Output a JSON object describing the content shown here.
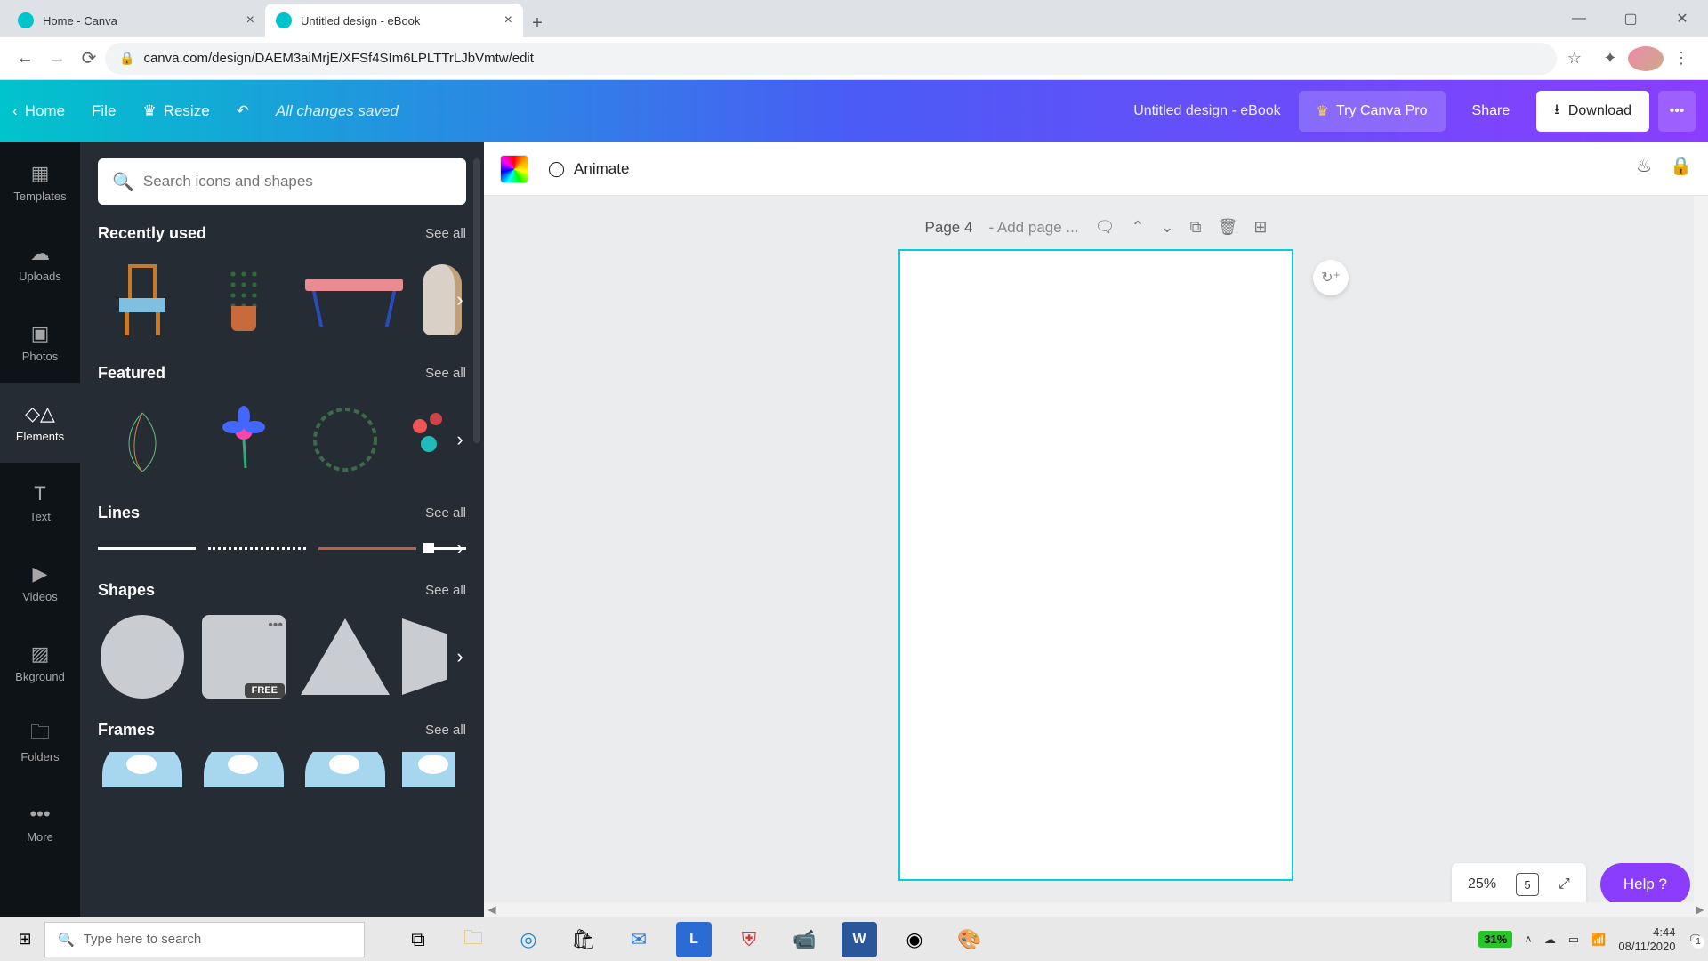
{
  "browser": {
    "tabs": [
      {
        "title": "Home - Canva",
        "active": false
      },
      {
        "title": "Untitled design - eBook",
        "active": true
      }
    ],
    "url": "canva.com/design/DAEM3aiMrjE/XFSf4SIm6LPLTTrLJbVmtw/edit"
  },
  "top": {
    "home": "Home",
    "file": "File",
    "resize": "Resize",
    "saved": "All changes saved",
    "title": "Untitled design - eBook",
    "try_pro": "Try Canva Pro",
    "share": "Share",
    "download": "Download"
  },
  "rail": {
    "items": [
      "Templates",
      "Uploads",
      "Photos",
      "Elements",
      "Text",
      "Videos",
      "Bkground",
      "Folders",
      "More"
    ],
    "active_index": 3
  },
  "panel": {
    "search_placeholder": "Search icons and shapes",
    "sections": {
      "recently_used": {
        "title": "Recently used",
        "see_all": "See all"
      },
      "featured": {
        "title": "Featured",
        "see_all": "See all"
      },
      "lines": {
        "title": "Lines",
        "see_all": "See all"
      },
      "shapes": {
        "title": "Shapes",
        "see_all": "See all",
        "free_badge": "FREE"
      },
      "frames": {
        "title": "Frames",
        "see_all": "See all"
      }
    }
  },
  "canvas": {
    "animate": "Animate",
    "page_label": "Page 4",
    "add_page": "- Add page ...",
    "zoom": "25%",
    "page_count": "5",
    "help": "Help  ?"
  },
  "taskbar": {
    "search_placeholder": "Type here to search",
    "battery": "31%",
    "time": "4:44",
    "date": "08/11/2020",
    "notif_count": "1"
  }
}
